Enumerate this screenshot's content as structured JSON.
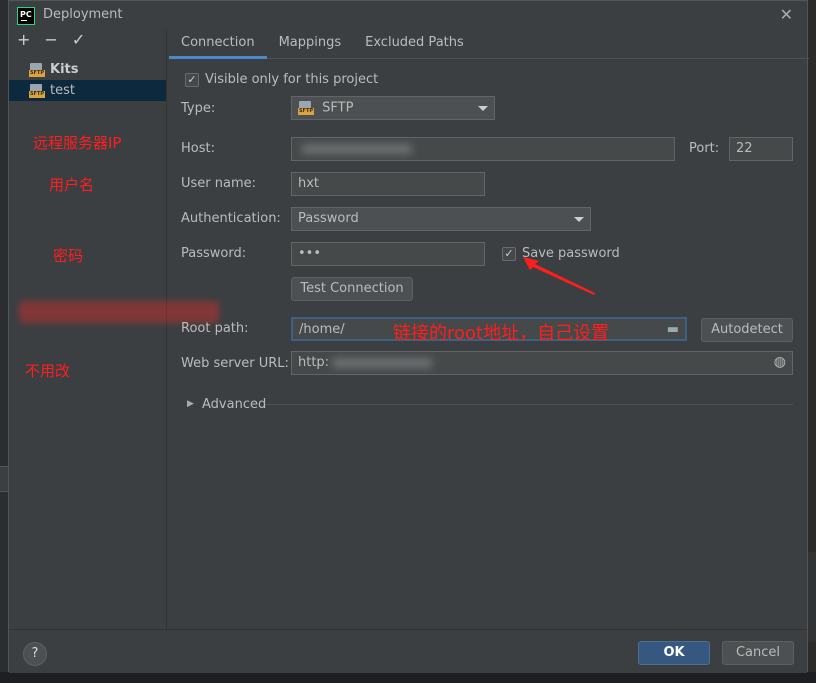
{
  "window": {
    "title": "Deployment",
    "app_icon": "PC"
  },
  "left_panel": {
    "toolbar": [
      {
        "label": "+",
        "name": "add-server-button"
      },
      {
        "label": "−",
        "name": "remove-server-button"
      },
      {
        "label": "✓",
        "name": "set-default-button"
      }
    ],
    "servers": [
      {
        "label": "Kits",
        "bold": true,
        "selected": false
      },
      {
        "label": "test",
        "bold": false,
        "selected": true
      }
    ]
  },
  "annotations": {
    "remote_ip": "远程服务器IP",
    "user_name": "用户名",
    "password": "密码",
    "no_change": "不用改",
    "root_note": "链接的root地址，自己设置"
  },
  "tabs": [
    "Connection",
    "Mappings",
    "Excluded Paths"
  ],
  "form": {
    "visible_only": "Visible only for this project",
    "type_label": "Type:",
    "type_value": "SFTP",
    "host_label": "Host:",
    "port_label": "Port:",
    "port_value": "22",
    "username_label": "User name:",
    "username_value": "hxt",
    "auth_label": "Authentication:",
    "auth_value": "Password",
    "password_label": "Password:",
    "password_value": "•••",
    "save_password": "Save password",
    "test_connection": "Test Connection",
    "root_label": "Root path:",
    "root_value": "/home/",
    "autodetect": "Autodetect",
    "web_label": "Web server URL:",
    "web_value": "http:",
    "advanced": "Advanced"
  },
  "footer": {
    "help": "?",
    "ok": "OK",
    "cancel": "Cancel"
  },
  "colors": {
    "dialog_bg": "#3c3f41",
    "accent": "#4a88c7",
    "annotation": "#ff1e1e",
    "ok_button": "#365880"
  }
}
